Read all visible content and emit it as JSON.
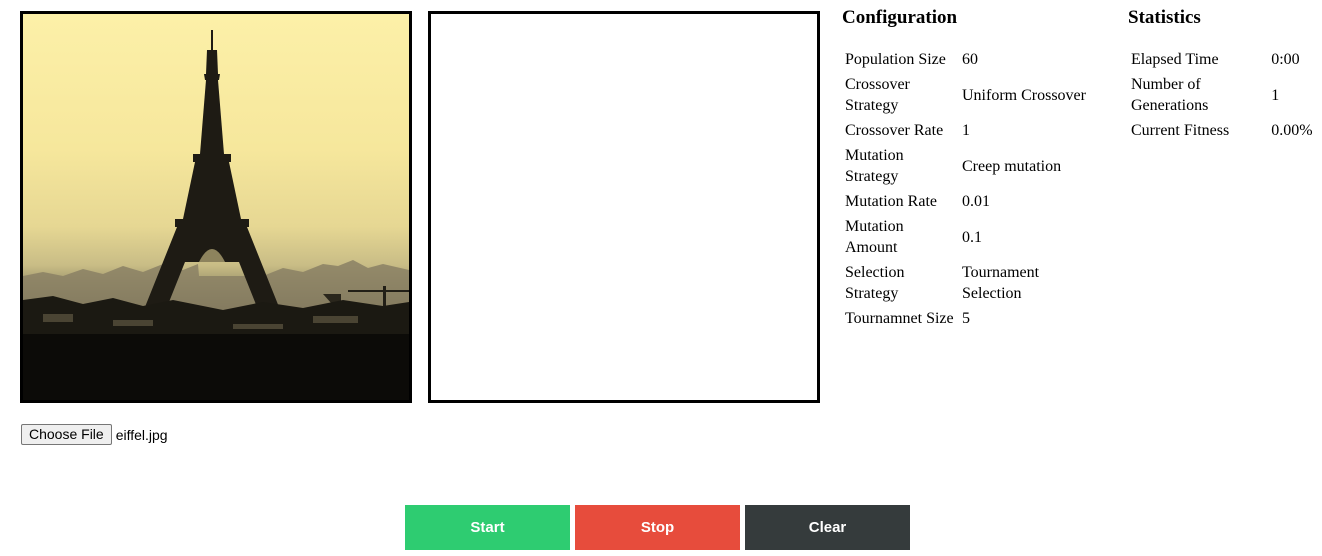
{
  "file": {
    "button_label": "Choose File",
    "file_name": "eiffel.jpg"
  },
  "configuration": {
    "title": "Configuration",
    "rows": [
      {
        "label": "Population Size",
        "value": "60"
      },
      {
        "label": "Crossover Strategy",
        "value": "Uniform Crossover"
      },
      {
        "label": "Crossover Rate",
        "value": "1"
      },
      {
        "label": "Mutation Strategy",
        "value": "Creep mutation"
      },
      {
        "label": "Mutation Rate",
        "value": "0.01"
      },
      {
        "label": "Mutation Amount",
        "value": "0.1"
      },
      {
        "label": "Selection Strategy",
        "value": "Tournament Selection"
      },
      {
        "label": "Tournamnet Size",
        "value": "5"
      }
    ]
  },
  "statistics": {
    "title": "Statistics",
    "rows": [
      {
        "label": "Elapsed Time",
        "value": "0:00"
      },
      {
        "label": "Number of Generations",
        "value": "1"
      },
      {
        "label": "Current Fitness",
        "value": "0.00%"
      }
    ]
  },
  "controls": {
    "start_label": "Start",
    "stop_label": "Stop",
    "clear_label": "Clear"
  },
  "colors": {
    "start": "#2ecc71",
    "stop": "#e74c3c",
    "clear": "#353b3c"
  }
}
